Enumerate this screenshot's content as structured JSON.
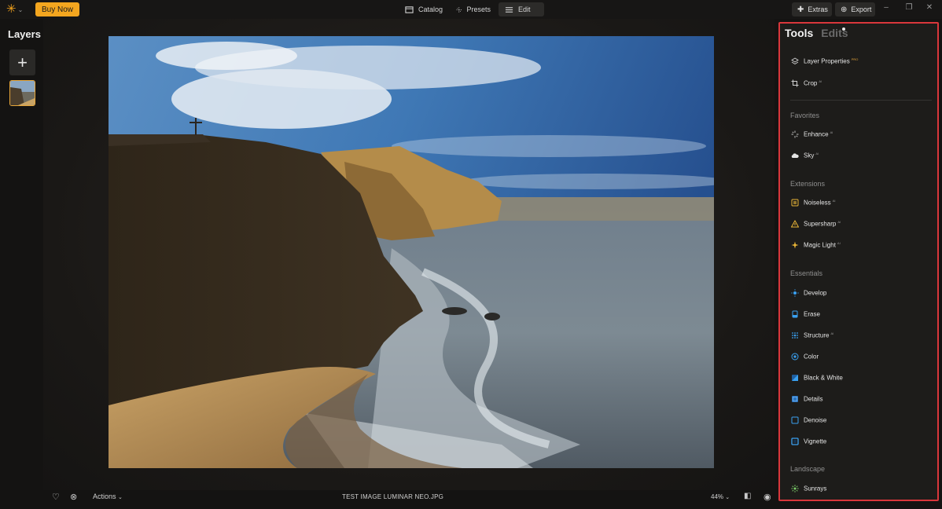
{
  "topbar": {
    "logo_icon": "luminar-star-icon",
    "buy_now": "Buy Now",
    "tabs": [
      {
        "label": "Catalog",
        "icon": "catalog-icon"
      },
      {
        "label": "Presets",
        "icon": "presets-icon"
      },
      {
        "label": "Edit",
        "icon": "edit-icon",
        "active": true
      }
    ],
    "extras": "Extras",
    "export": "Export"
  },
  "layers": {
    "title": "Layers",
    "add_icon": "plus-icon"
  },
  "canvas": {
    "image_icon": "landscape-photo"
  },
  "bottombar": {
    "actions": "Actions",
    "filename": "TEST IMAGE LUMINAR NEO.JPG",
    "zoom": "44%"
  },
  "tools": {
    "tab_tools": "Tools",
    "tab_edits": "Edits",
    "top_items": [
      {
        "label": "Layer Properties",
        "badge": "PRO"
      },
      {
        "label": "Crop",
        "badge": "AI"
      }
    ],
    "sections": [
      {
        "title": "Favorites",
        "items": [
          {
            "label": "Enhance",
            "badge": "AI"
          },
          {
            "label": "Sky",
            "badge": "AI"
          }
        ]
      },
      {
        "title": "Extensions",
        "items": [
          {
            "label": "Noiseless",
            "badge": "AI"
          },
          {
            "label": "Supersharp",
            "badge": "AI"
          },
          {
            "label": "Magic Light",
            "badge": "AI"
          }
        ]
      },
      {
        "title": "Essentials",
        "items": [
          {
            "label": "Develop",
            "badge": ""
          },
          {
            "label": "Erase",
            "badge": ""
          },
          {
            "label": "Structure",
            "badge": "AI"
          },
          {
            "label": "Color",
            "badge": ""
          },
          {
            "label": "Black & White",
            "badge": ""
          },
          {
            "label": "Details",
            "badge": ""
          },
          {
            "label": "Denoise",
            "badge": ""
          },
          {
            "label": "Vignette",
            "badge": ""
          }
        ]
      },
      {
        "title": "Landscape",
        "items": [
          {
            "label": "Sunrays",
            "badge": ""
          }
        ]
      }
    ]
  },
  "colors": {
    "accent": "#f3a61f",
    "highlight_border": "#d9373b"
  }
}
